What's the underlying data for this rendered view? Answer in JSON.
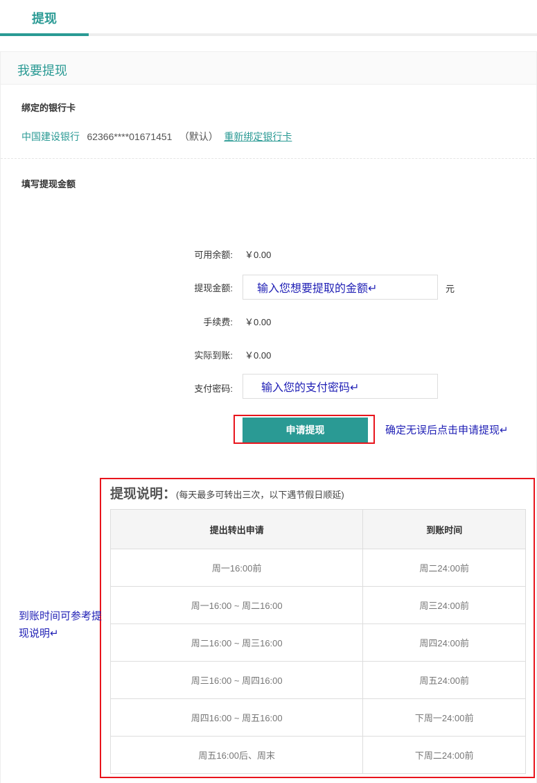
{
  "tab": {
    "label": "提现"
  },
  "section": {
    "title": "我要提现"
  },
  "bank": {
    "label": "绑定的银行卡",
    "name": "中国建设银行",
    "number": "62366****01671451",
    "default": "（默认）",
    "rebind": "重新绑定银行卡"
  },
  "amount_section": {
    "label": "填写提现金额"
  },
  "form": {
    "available_label": "可用余额:",
    "available_value": "￥0.00",
    "amount_label": "提现金额:",
    "amount_value": "输入您想要提取的金额↵",
    "unit": "元",
    "fee_label": "手续费:",
    "fee_value": "￥0.00",
    "actual_label": "实际到账:",
    "actual_value": "￥0.00",
    "password_label": "支付密码:",
    "password_value": "输入您的支付密码↵"
  },
  "submit": {
    "label": "申请提现",
    "note": "确定无误后点击申请提现↵"
  },
  "rules": {
    "title": "提现说明：",
    "subtitle": "(每天最多可转出三次，以下遇节假日顺延)",
    "headers": [
      "提出转出申请",
      "到账时间"
    ],
    "rows": [
      [
        "周一16:00前",
        "周二24:00前"
      ],
      [
        "周一16:00 ~ 周二16:00",
        "周三24:00前"
      ],
      [
        "周二16:00 ~ 周三16:00",
        "周四24:00前"
      ],
      [
        "周三16:00 ~ 周四16:00",
        "周五24:00前"
      ],
      [
        "周四16:00 ~ 周五16:00",
        "下周一24:00前"
      ],
      [
        "周五16:00后、周末",
        "下周二24:00前"
      ]
    ]
  },
  "side_note": "到账时间可参考提现说明↵"
}
